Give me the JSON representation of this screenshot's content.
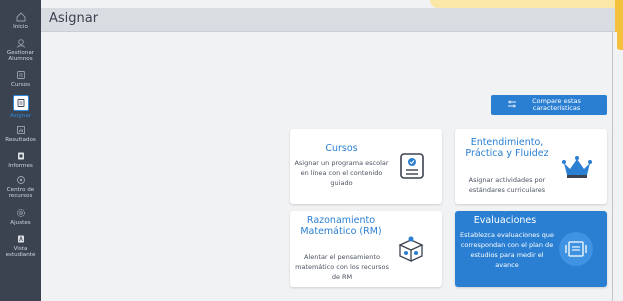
{
  "sidebar": {
    "items": [
      {
        "label": "Inicio",
        "icon": "home-icon"
      },
      {
        "label": "Gestionar Alumnos",
        "icon": "students-icon"
      },
      {
        "label": "Cursos",
        "icon": "courses-icon"
      },
      {
        "label": "Asignar",
        "icon": "assign-icon",
        "active": true
      },
      {
        "label": "Resultados",
        "icon": "results-icon"
      },
      {
        "label": "Informes",
        "icon": "reports-icon"
      },
      {
        "label": "Centro de recursos",
        "icon": "resource-center-icon"
      },
      {
        "label": "Ajustes",
        "icon": "settings-icon"
      },
      {
        "label": "Vista estudiante",
        "icon": "student-view-icon"
      }
    ]
  },
  "header": {
    "title": "Asignar"
  },
  "compare": {
    "label": "Compare estas características"
  },
  "cards": {
    "cursos": {
      "title": "Cursos",
      "description": "Asignar un programa escolar en línea con el contenido guiado"
    },
    "entendimiento": {
      "title": "Entendimiento, Práctica y Fluidez",
      "description": "Asignar actividades por estándares curriculares"
    },
    "rm": {
      "title": "Razonamiento Matemático (RM)",
      "description": "Alentar el pensamiento matemático con los recursos de RM"
    },
    "evaluaciones": {
      "title": "Evaluaciones",
      "description": "Establezca evaluaciones que correspondan con el plan de estudios para medir el avance"
    }
  },
  "colors": {
    "accent": "#2a7fd2",
    "sidebar": "#3b4250",
    "highlight": "#f4c13d"
  }
}
